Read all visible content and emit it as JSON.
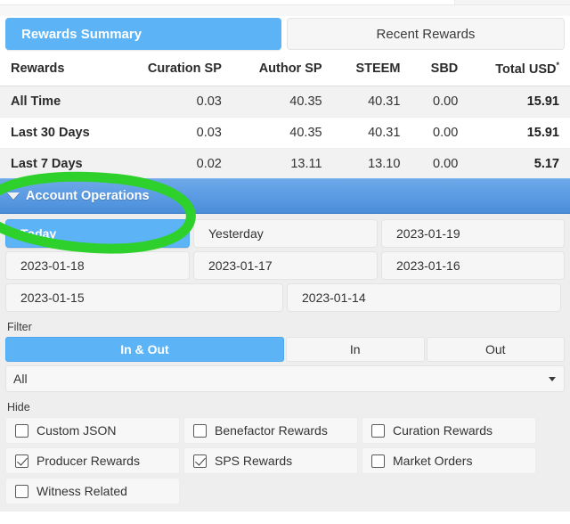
{
  "tabs": [
    {
      "label": "Rewards Summary",
      "active": true
    },
    {
      "label": "Recent Rewards",
      "active": false
    }
  ],
  "rewards_table": {
    "headers": [
      "Rewards",
      "Curation SP",
      "Author SP",
      "STEEM",
      "SBD",
      "Total USD"
    ],
    "total_header_superscript": "*",
    "rows": [
      {
        "label": "All Time",
        "curation_sp": "0.03",
        "author_sp": "40.35",
        "steem": "40.31",
        "sbd": "0.00",
        "total_usd": "15.91"
      },
      {
        "label": "Last 30 Days",
        "curation_sp": "0.03",
        "author_sp": "40.35",
        "steem": "40.31",
        "sbd": "0.00",
        "total_usd": "15.91"
      },
      {
        "label": "Last 7 Days",
        "curation_sp": "0.02",
        "author_sp": "13.11",
        "steem": "13.10",
        "sbd": "0.00",
        "total_usd": "5.17"
      }
    ]
  },
  "account_operations": {
    "title": "Account Operations",
    "collapse_icon": "caret-down-icon",
    "date_chips": [
      [
        {
          "label": "Today",
          "active": true
        },
        {
          "label": "Yesterday",
          "active": false
        },
        {
          "label": "2023-01-19",
          "active": false
        }
      ],
      [
        {
          "label": "2023-01-18",
          "active": false
        },
        {
          "label": "2023-01-17",
          "active": false
        },
        {
          "label": "2023-01-16",
          "active": false
        }
      ],
      [
        {
          "label": "2023-01-15",
          "active": false
        },
        {
          "label": "2023-01-14",
          "active": false
        }
      ]
    ],
    "filter": {
      "label": "Filter",
      "segments": [
        {
          "label": "In & Out",
          "active": true
        },
        {
          "label": "In",
          "active": false
        },
        {
          "label": "Out",
          "active": false
        }
      ],
      "select_value": "All"
    },
    "hide": {
      "label": "Hide",
      "options": [
        [
          {
            "label": "Custom JSON",
            "checked": false
          },
          {
            "label": "Benefactor Rewards",
            "checked": false
          },
          {
            "label": "Curation Rewards",
            "checked": false
          }
        ],
        [
          {
            "label": "Producer Rewards",
            "checked": true
          },
          {
            "label": "SPS Rewards",
            "checked": true
          },
          {
            "label": "Market Orders",
            "checked": false
          }
        ],
        [
          {
            "label": "Witness Related",
            "checked": false
          }
        ]
      ]
    }
  },
  "annotation": {
    "type": "hand-drawn-ellipse",
    "color": "#2ed02b",
    "target": "Account Operations"
  },
  "colors": {
    "accent_blue": "#5cb3f5",
    "header_blue": "#5c9ce4",
    "annotation_green": "#2ed02b",
    "panel_gray": "#eeeeee",
    "row_stripe": "#f2f2f2"
  }
}
